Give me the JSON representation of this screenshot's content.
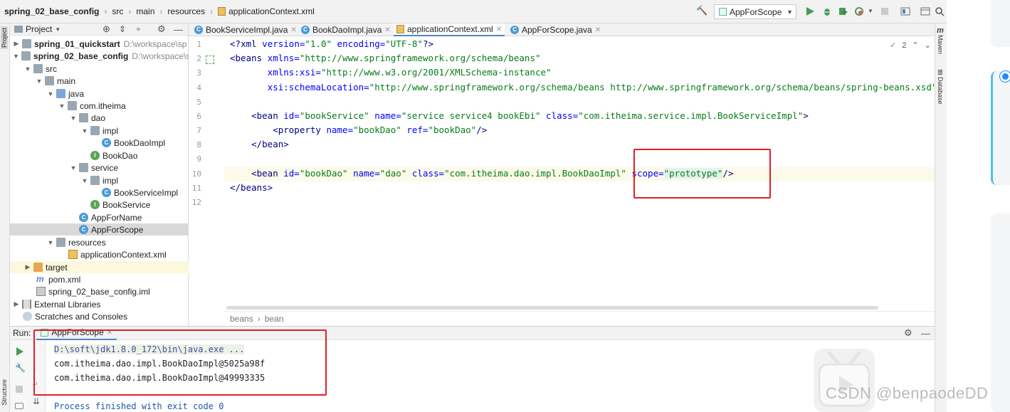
{
  "breadcrumb": {
    "project": "spring_02_base_config",
    "p1": "src",
    "p2": "main",
    "p3": "resources",
    "file": "applicationContext.xml"
  },
  "toolbar": {
    "run_config": "AppForScope"
  },
  "left_strip": {
    "project_label": "Project",
    "structure_label": "Structure"
  },
  "right_strip": {
    "maven_label": "Maven",
    "database_label": "Database"
  },
  "project_panel": {
    "title": "Project",
    "tree": [
      {
        "label": "spring_01_quickstart",
        "path": "D:\\workspace\\sp",
        "bold": true
      },
      {
        "label": "spring_02_base_config",
        "path": "D:\\workspace\\s",
        "bold": true
      },
      {
        "label": "src"
      },
      {
        "label": "main"
      },
      {
        "label": "java"
      },
      {
        "label": "com.itheima"
      },
      {
        "label": "dao"
      },
      {
        "label": "impl"
      },
      {
        "label": "BookDaoImpl"
      },
      {
        "label": "BookDao"
      },
      {
        "label": "service"
      },
      {
        "label": "impl"
      },
      {
        "label": "BookServiceImpl"
      },
      {
        "label": "BookService"
      },
      {
        "label": "AppForName"
      },
      {
        "label": "AppForScope"
      },
      {
        "label": "resources"
      },
      {
        "label": "applicationContext.xml"
      },
      {
        "label": "target"
      },
      {
        "label": "pom.xml"
      },
      {
        "label": "spring_02_base_config.iml"
      },
      {
        "label": "External Libraries"
      },
      {
        "label": "Scratches and Consoles"
      }
    ]
  },
  "tabs": [
    {
      "label": "BookServiceImpl.java"
    },
    {
      "label": "BookDaoImpl.java"
    },
    {
      "label": "applicationContext.xml"
    },
    {
      "label": "AppForScope.java"
    }
  ],
  "editor": {
    "line_numbers": [
      "1",
      "2",
      "3",
      "4",
      "5",
      "6",
      "7",
      "8",
      "9",
      "10",
      "11",
      "12"
    ],
    "l1": {
      "a": "<?",
      "b": "xml",
      "c": " version=",
      "d": "\"1.0\"",
      "e": " encoding=",
      "f": "\"UTF-8\"",
      "g": "?>"
    },
    "l2": {
      "a": "<beans",
      "b": " xmlns=",
      "c": "\"http://www.springframework.org/schema/beans\""
    },
    "l3": {
      "a": "       xmlns:xsi=",
      "b": "\"http://www.w3.org/2001/XMLSchema-instance\""
    },
    "l4": {
      "a": "       xsi:schemaLocation=",
      "b": "\"http://www.springframework.org/schema/beans http://www.springframework.org/schema/beans/spring-beans.xsd\""
    },
    "l6": {
      "a": "    <bean",
      "b": " id=",
      "c": "\"bookService\"",
      "d": " name=",
      "e": "\"service service4 bookEbi\"",
      "f": " class=",
      "g": "\"com.itheima.service.impl.BookServiceImpl\"",
      "h": ">"
    },
    "l7": {
      "a": "        <property",
      "b": " name=",
      "c": "\"bookDao\"",
      "d": " ref=",
      "e": "\"bookDao\"",
      "f": "/>"
    },
    "l8": {
      "a": "    </bean>"
    },
    "l10": {
      "a": "    <bean",
      "b": " id=",
      "c": "\"bookDao\"",
      "d": " name=",
      "e": "\"dao\"",
      "f": " class=",
      "g": "\"com.itheima.dao.impl.BookDaoImpl\"",
      "h": " scope=",
      "i": "\"prototype\"",
      "j": "/>"
    },
    "l11": {
      "a": "</beans>"
    },
    "inspection_count": "2",
    "crumb1": "beans",
    "crumb2": "bean"
  },
  "run": {
    "label": "Run:",
    "tab": "AppForScope",
    "lines": [
      "D:\\soft\\jdk1.8.0_172\\bin\\java.exe ...",
      "com.itheima.dao.impl.BookDaoImpl@5025a98f",
      "com.itheima.dao.impl.BookDaoImpl@49993335",
      "Process finished with exit code 0"
    ]
  },
  "watermark": "CSDN @benpaodeDD",
  "colors": {
    "highlight_box": "#e0202a",
    "accent": "#4a88c7"
  }
}
